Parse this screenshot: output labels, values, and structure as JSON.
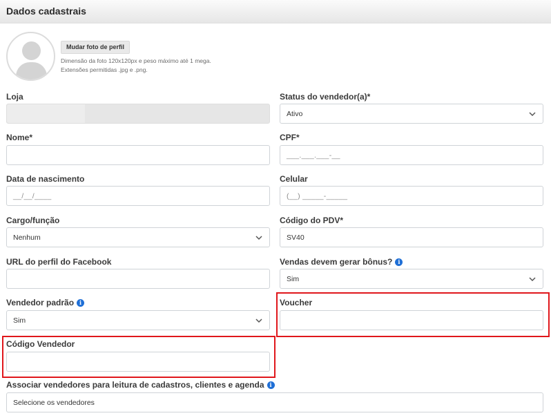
{
  "header": {
    "title": "Dados cadastrais"
  },
  "photo": {
    "button_label": "Mudar foto de perfil",
    "help_line1": "Dimensão da foto 120x120px e peso máximo até 1 mega.",
    "help_line2": "Extensões permitidas .jpg e .png."
  },
  "form": {
    "loja": {
      "label": "Loja",
      "value": ""
    },
    "status": {
      "label": "Status do vendedor(a)*",
      "value": "Ativo"
    },
    "nome": {
      "label": "Nome*",
      "value": ""
    },
    "cpf": {
      "label": "CPF*",
      "mask": "___.___.___-__"
    },
    "nascimento": {
      "label": "Data de nascimento",
      "mask": "__/__/____"
    },
    "celular": {
      "label": "Celular",
      "mask": "(__) _____-_____"
    },
    "cargo": {
      "label": "Cargo/função",
      "value": "Nenhum"
    },
    "pdv": {
      "label": "Código do PDV*",
      "value": "SV40"
    },
    "facebook": {
      "label": "URL do perfil do Facebook",
      "value": ""
    },
    "bonus": {
      "label": "Vendas devem gerar bônus?",
      "value": "Sim"
    },
    "vendedor_padrao": {
      "label": "Vendedor padrão",
      "value": "Sim"
    },
    "voucher": {
      "label": "Voucher",
      "value": ""
    },
    "codigo_vendedor": {
      "label": "Código Vendedor",
      "value": ""
    },
    "associar": {
      "label": "Associar vendedores para leitura de cadastros, clientes e agenda",
      "placeholder": "Selecione os vendedores"
    }
  },
  "colors": {
    "highlight": "#e0161b",
    "info": "#1f6fd6",
    "disabled": "#e6e6e6"
  },
  "icons": {
    "info": "info-icon",
    "chevron": "chevron-down-icon",
    "avatar": "user-avatar-icon"
  }
}
